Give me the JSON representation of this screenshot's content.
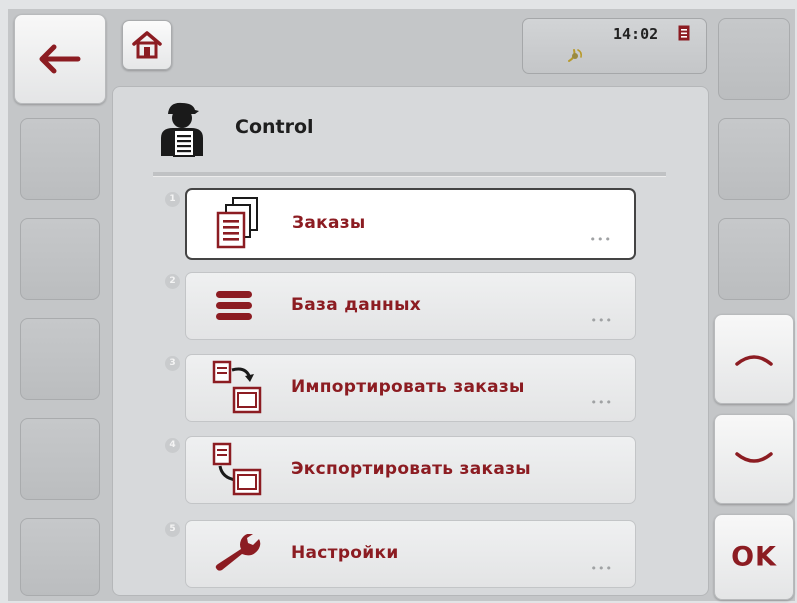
{
  "status": {
    "time": "14:02"
  },
  "header": {
    "title": "Control"
  },
  "menu": {
    "items": [
      {
        "number": "1",
        "label": "Заказы",
        "more": "•••",
        "icon": "orders-icon"
      },
      {
        "number": "2",
        "label": "База данных",
        "more": "•••",
        "icon": "database-icon"
      },
      {
        "number": "3",
        "label": "Импортировать заказы",
        "more": "•••",
        "icon": "import-orders-icon"
      },
      {
        "number": "4",
        "label": "Экспортировать заказы",
        "more": "",
        "icon": "export-orders-icon"
      },
      {
        "number": "5",
        "label": "Настройки",
        "more": "•••",
        "icon": "wrench-icon"
      }
    ]
  },
  "softkeys": {
    "ok_label": "OK"
  },
  "colors": {
    "accent": "#8c1c22",
    "background": "#c4c6c8",
    "panel": "#d7d9db"
  }
}
